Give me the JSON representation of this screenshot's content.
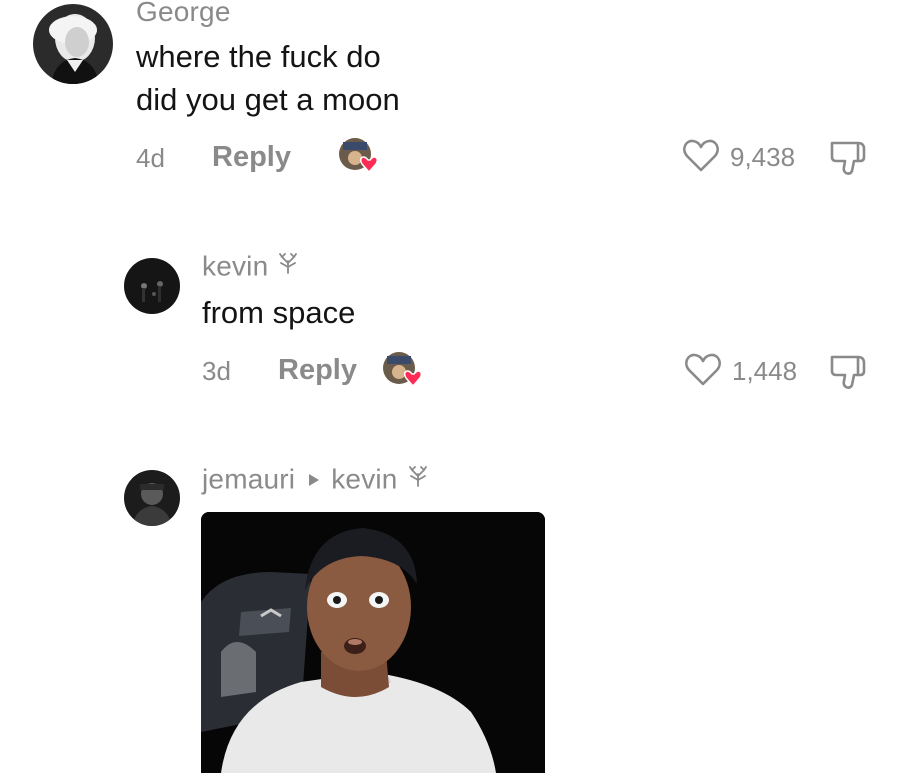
{
  "comments": [
    {
      "username": "George",
      "text_lines": [
        "where the fuck do",
        "did you get a moon"
      ],
      "time": "4d",
      "reply_label": "Reply",
      "likes": "9,438",
      "avatar": "george-washington-portrait"
    },
    {
      "username": "kevin",
      "text_lines": [
        "from space"
      ],
      "time": "3d",
      "reply_label": "Reply",
      "likes": "1,448",
      "avatar": "dark-photo",
      "badge": "tree-icon"
    },
    {
      "username": "jemauri",
      "reply_to": "kevin",
      "avatar": "dark-photo",
      "badge": "tree-icon",
      "media": "video-thumbnail"
    }
  ],
  "colors": {
    "text": "#141414",
    "muted": "#8a8a8a",
    "heart": "#fe2c55"
  }
}
